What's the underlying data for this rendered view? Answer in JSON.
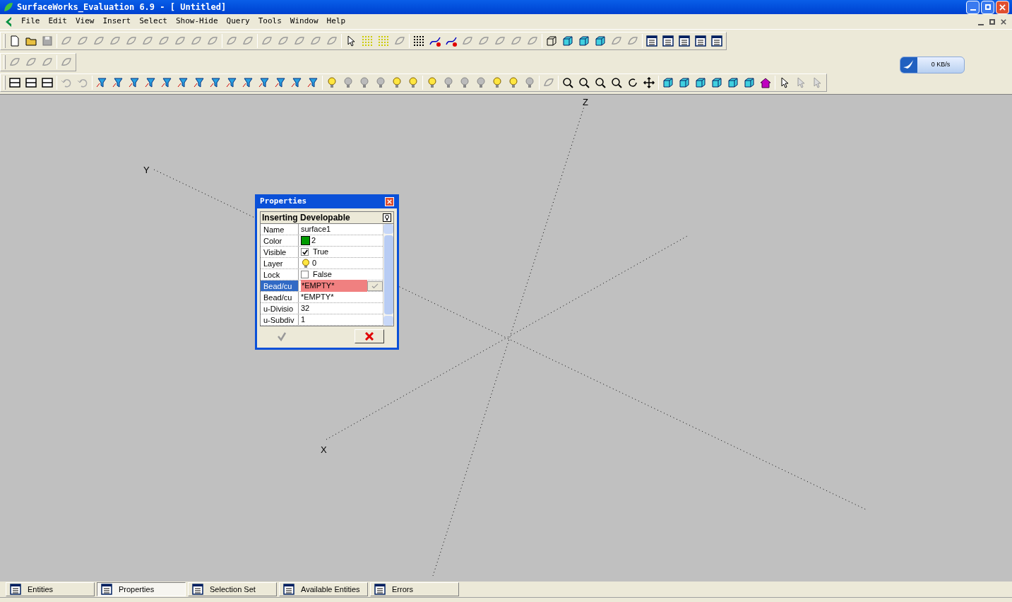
{
  "window": {
    "title": "SurfaceWorks_Evaluation 6.9 - [ Untitled]"
  },
  "menu": [
    "File",
    "Edit",
    "View",
    "Insert",
    "Select",
    "Show-Hide",
    "Query",
    "Tools",
    "Window",
    "Help"
  ],
  "speed_widget": {
    "reading": "0 KB/s"
  },
  "viewport": {
    "axes": [
      {
        "label": "Z"
      },
      {
        "label": "Y"
      },
      {
        "label": "X"
      }
    ]
  },
  "properties": {
    "title": "Properties",
    "heading": "Inserting Developable",
    "rows": [
      {
        "name": "Name",
        "value": "surface1",
        "kind": "text",
        "selected": false
      },
      {
        "name": "Color",
        "value": "2",
        "kind": "color",
        "color": "#009a00",
        "selected": false
      },
      {
        "name": "Visible",
        "value": "True",
        "kind": "checkbox",
        "checked": true,
        "selected": false
      },
      {
        "name": "Layer",
        "value": "0",
        "kind": "layer",
        "selected": false
      },
      {
        "name": "Lock",
        "value": "False",
        "kind": "checkbox",
        "checked": false,
        "selected": false
      },
      {
        "name": "Bead/cu",
        "value": "*EMPTY*",
        "kind": "picker",
        "selected": true
      },
      {
        "name": "Bead/cu",
        "value": "*EMPTY*",
        "kind": "text",
        "selected": false
      },
      {
        "name": "u-Divisio",
        "value": "32",
        "kind": "text",
        "selected": false
      },
      {
        "name": "u-Subdiv",
        "value": "1",
        "kind": "text",
        "selected": false
      }
    ]
  },
  "bottom_tabs": [
    {
      "label": "Entities",
      "selected": false
    },
    {
      "label": "Properties",
      "selected": true
    },
    {
      "label": "Selection Set",
      "selected": false
    },
    {
      "label": "Available Entities",
      "selected": false
    },
    {
      "label": "Errors",
      "selected": false
    }
  ]
}
